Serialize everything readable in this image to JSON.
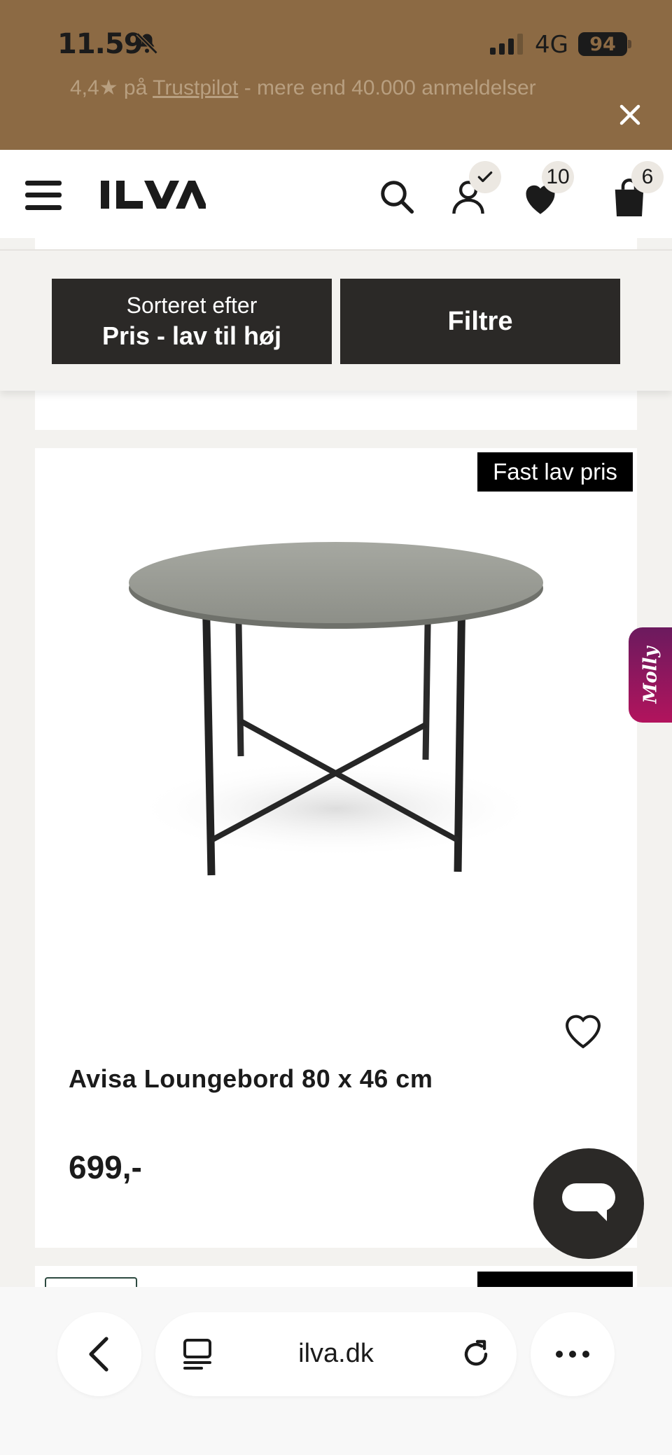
{
  "status_bar": {
    "time": "11.59",
    "network": "4G",
    "battery": "94"
  },
  "banner": {
    "rating_text": "4,4★ på ",
    "trustpilot_link": "Trustpilot",
    "reviews_text": " - mere end 40.000 anmeldelser",
    "background_color": "#8c6a44"
  },
  "header": {
    "logo": "ILVA",
    "favorites_count": "10",
    "cart_count": "6"
  },
  "sort_bar": {
    "sort_label": "Sorteret efter",
    "sort_value": "Pris - lav til høj",
    "filter_label": "Filtre"
  },
  "product": {
    "tag": "Fast lav pris",
    "name": "Avisa Loungebord 80 x 46 cm",
    "price": "699,-"
  },
  "side_tab": {
    "label": "Molly"
  },
  "browser": {
    "url": "ilva.dk"
  }
}
